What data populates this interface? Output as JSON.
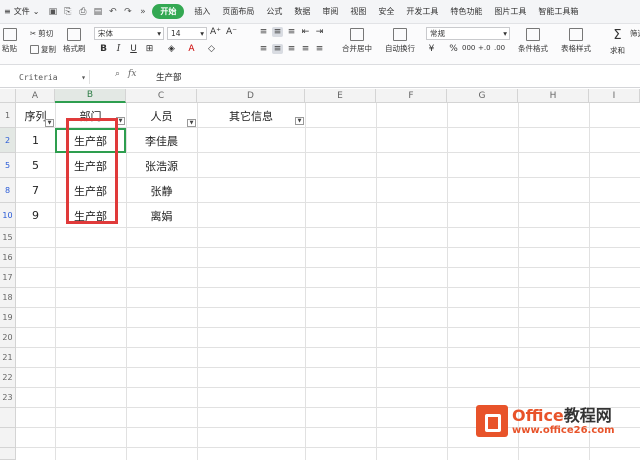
{
  "menubar": {
    "file": "文件",
    "tabs": [
      "开始",
      "插入",
      "页面布局",
      "公式",
      "数据",
      "审阅",
      "视图",
      "安全",
      "开发工具",
      "特色功能",
      "图片工具",
      "智能工具箱"
    ],
    "active_tab": "开始"
  },
  "ribbon": {
    "paste": "粘贴",
    "cut": "剪切",
    "copy": "复制",
    "format_painter": "格式刷",
    "font_name": "宋体",
    "font_size": "14",
    "merge_center": "合并居中",
    "wrap_text": "自动换行",
    "number_format": "常规",
    "conditional_format": "条件格式",
    "table_style": "表格样式",
    "sum": "求和",
    "filter": "筛选"
  },
  "formula_bar": {
    "name_box": "Criteria",
    "fx": "fx",
    "value": "生产部"
  },
  "columns": [
    "A",
    "B",
    "C",
    "D",
    "E",
    "F",
    "G",
    "H",
    "I"
  ],
  "selected_column": "B",
  "row_numbers": [
    "1",
    "2",
    "5",
    "8",
    "10",
    "15",
    "16",
    "17",
    "18",
    "19",
    "20",
    "21",
    "22",
    "23"
  ],
  "header_row": {
    "a": "序列",
    "b": "部门",
    "c": "人员",
    "d": "其它信息"
  },
  "rows": [
    {
      "seq": "1",
      "dept": "生产部",
      "person": "李佳晨"
    },
    {
      "seq": "5",
      "dept": "生产部",
      "person": "张浩源"
    },
    {
      "seq": "7",
      "dept": "生产部",
      "person": "张静"
    },
    {
      "seq": "9",
      "dept": "生产部",
      "person": "离娟"
    }
  ],
  "watermark": {
    "brand": "Office",
    "brand_cn": "教程网",
    "url": "www.office26.com"
  }
}
